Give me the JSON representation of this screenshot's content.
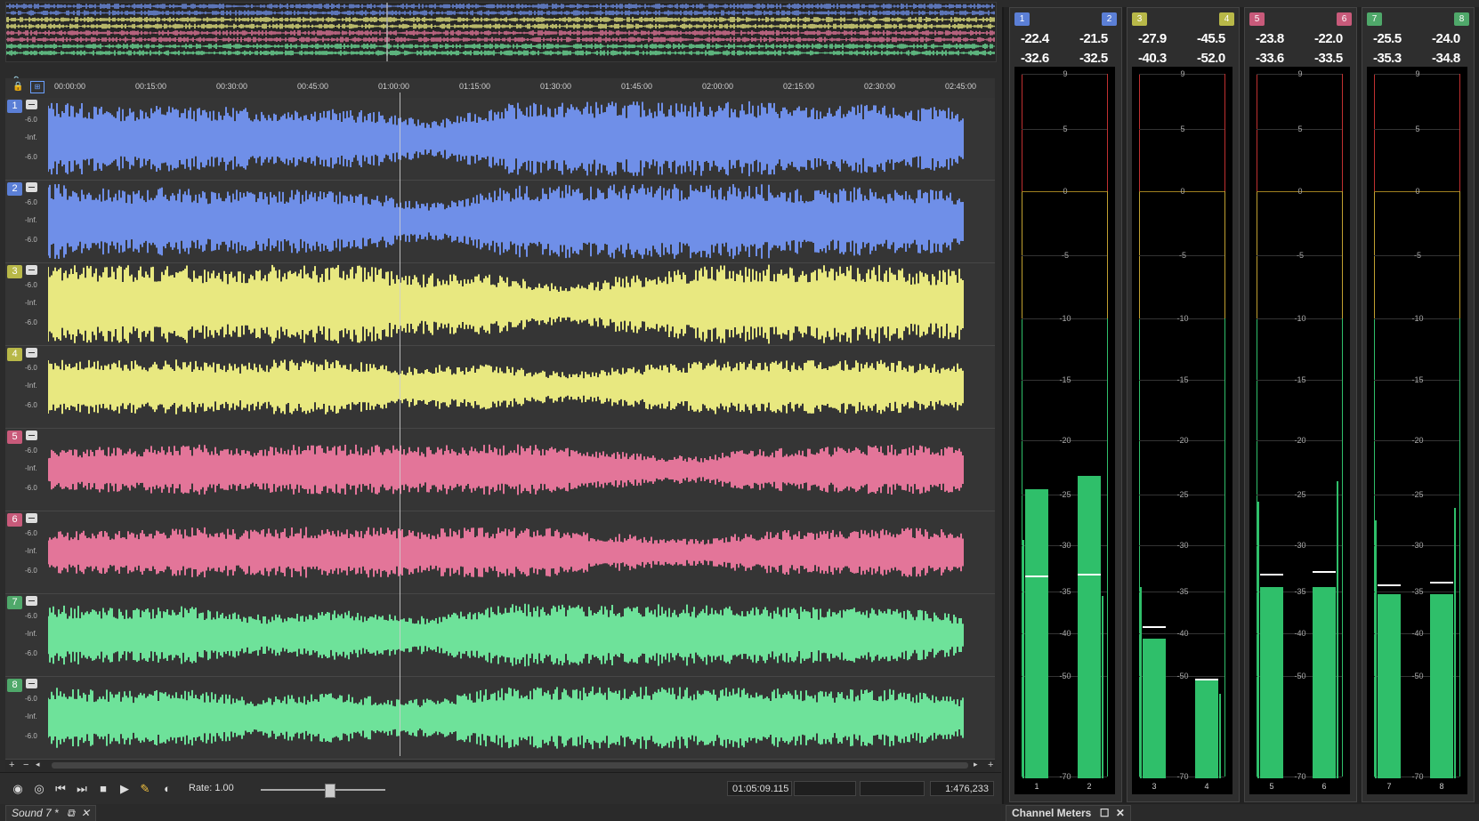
{
  "ruler": {
    "ticks": [
      "00:00:00",
      "00:15:00",
      "00:30:00",
      "00:45:00",
      "01:00:00",
      "01:15:00",
      "01:30:00",
      "01:45:00",
      "02:00:00",
      "02:15:00",
      "02:30:00",
      "02:45:00"
    ]
  },
  "tracks": [
    {
      "num": "1",
      "color": "#5b7fd6",
      "levels": [
        "-6.0",
        "-Inf.",
        "-6.0"
      ],
      "wave_color": "#6f8fe8",
      "amplitude": 0.75
    },
    {
      "num": "2",
      "color": "#5b7fd6",
      "levels": [
        "-6.0",
        "-Inf.",
        "-6.0"
      ],
      "wave_color": "#6f8fe8",
      "amplitude": 0.75
    },
    {
      "num": "3",
      "color": "#b8b848",
      "levels": [
        "-6.0",
        "-Inf.",
        "-6.0"
      ],
      "wave_color": "#e8e880",
      "amplitude": 0.8
    },
    {
      "num": "4",
      "color": "#b8b848",
      "levels": [
        "-6.0",
        "-Inf.",
        "-6.0"
      ],
      "wave_color": "#e8e880",
      "amplitude": 0.5
    },
    {
      "num": "5",
      "color": "#c85a7a",
      "levels": [
        "-6.0",
        "-Inf.",
        "-6.0"
      ],
      "wave_color": "#e37599",
      "amplitude": 0.45
    },
    {
      "num": "6",
      "color": "#c85a7a",
      "levels": [
        "-6.0",
        "-Inf.",
        "-6.0"
      ],
      "wave_color": "#e37599",
      "amplitude": 0.45
    },
    {
      "num": "7",
      "color": "#4fa86a",
      "levels": [
        "-6.0",
        "-Inf.",
        "-6.0"
      ],
      "wave_color": "#6ee29a",
      "amplitude": 0.6
    },
    {
      "num": "8",
      "color": "#4fa86a",
      "levels": [
        "-6.0",
        "-Inf.",
        "-6.0"
      ],
      "wave_color": "#6ee29a",
      "amplitude": 0.6
    }
  ],
  "transport": {
    "rate_label": "Rate: 1.00",
    "position": "01:05:09.115",
    "samples": "1:476,233"
  },
  "document_tab": {
    "label": "Sound 7 *"
  },
  "meters_tab": {
    "label": "Channel Meters"
  },
  "meter_groups": [
    {
      "ch_left": "1",
      "ch_right": "2",
      "color": "#5b7fd6",
      "peak_left": "-22.4",
      "peak_right": "-21.5",
      "rms_left": "-32.6",
      "rms_right": "-32.5",
      "level_left_db": -29.5,
      "level_right_db": -35.5,
      "bar_left_db": -24.5,
      "bar_right_db": -23.3,
      "hold_left_db": -34.0,
      "hold_right_db": -33.8
    },
    {
      "ch_left": "3",
      "ch_right": "4",
      "color": "#b8b848",
      "peak_left": "-27.9",
      "peak_right": "-45.5",
      "rms_left": "-40.3",
      "rms_right": "-52.0",
      "level_left_db": -34.5,
      "level_right_db": -53.5,
      "bar_left_db": -41.3,
      "bar_right_db": -50.5,
      "hold_left_db": -40.0,
      "hold_right_db": -52.0
    },
    {
      "ch_left": "5",
      "ch_right": "6",
      "color": "#c85a7a",
      "peak_left": "-23.8",
      "peak_right": "-22.0",
      "rms_left": "-33.6",
      "rms_right": "-33.5",
      "level_left_db": -25.7,
      "level_right_db": -23.8,
      "bar_left_db": -34.5,
      "bar_right_db": -34.5,
      "hold_left_db": -33.8,
      "hold_right_db": -33.6
    },
    {
      "ch_left": "7",
      "ch_right": "8",
      "color": "#4fa86a",
      "peak_left": "-25.5",
      "peak_right": "-24.0",
      "rms_left": "-35.3",
      "rms_right": "-34.8",
      "level_left_db": -27.5,
      "level_right_db": -26.3,
      "bar_left_db": -35.3,
      "bar_right_db": -35.3,
      "hold_left_db": -35.0,
      "hold_right_db": -34.7
    }
  ],
  "meter_scale": [
    "9",
    "5",
    "0",
    "-5",
    "-10",
    "-15",
    "-20",
    "-25",
    "-30",
    "-35",
    "-40",
    "-50",
    "-70"
  ]
}
